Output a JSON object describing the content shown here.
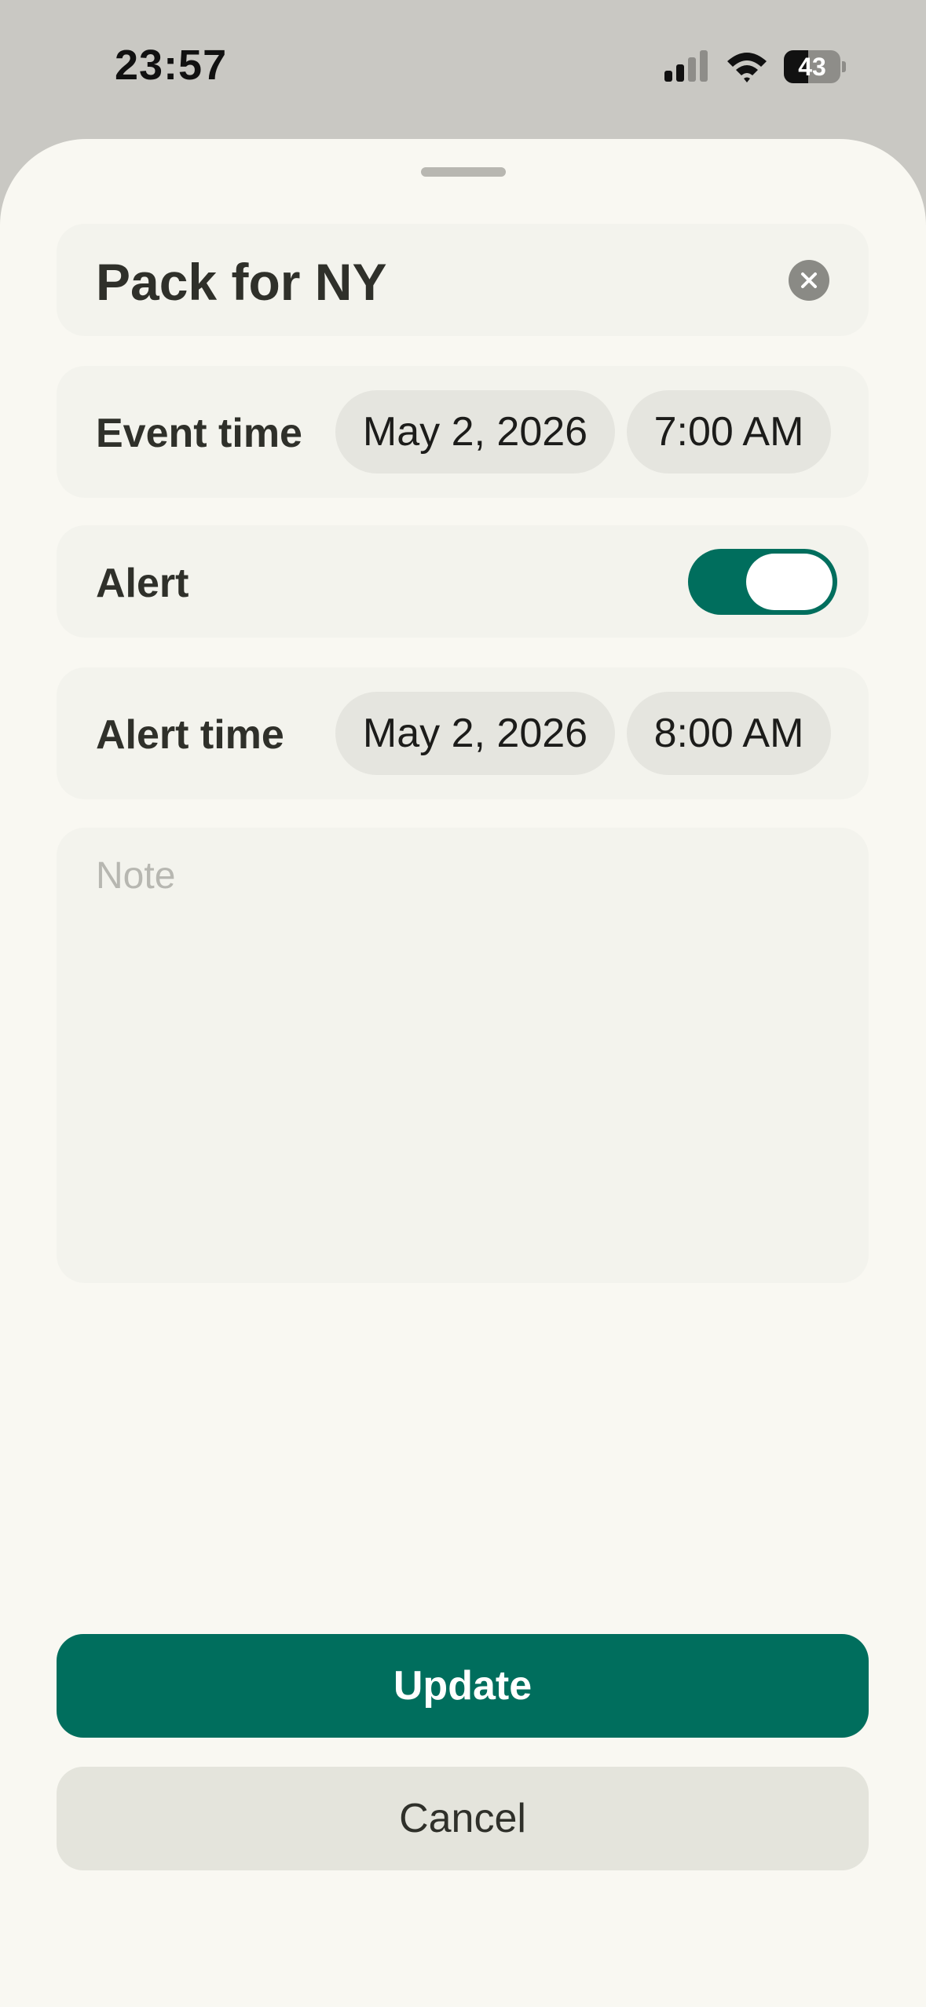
{
  "status_bar": {
    "time": "23:57",
    "battery": "43",
    "battery_level": 0.43
  },
  "form": {
    "title": "Pack for NY",
    "event_time": {
      "label": "Event time",
      "date": "May 2, 2026",
      "time": "7:00 AM"
    },
    "alert": {
      "label": "Alert",
      "enabled": true
    },
    "alert_time": {
      "label": "Alert time",
      "date": "May 2, 2026",
      "time": "8:00 AM"
    },
    "note": {
      "placeholder": "Note",
      "value": ""
    }
  },
  "actions": {
    "update_label": "Update",
    "cancel_label": "Cancel"
  },
  "colors": {
    "accent": "#006e5d",
    "sheet_bg": "#f9f8f2",
    "card_bg": "#f3f3ed",
    "pill_bg": "#e5e5df"
  }
}
